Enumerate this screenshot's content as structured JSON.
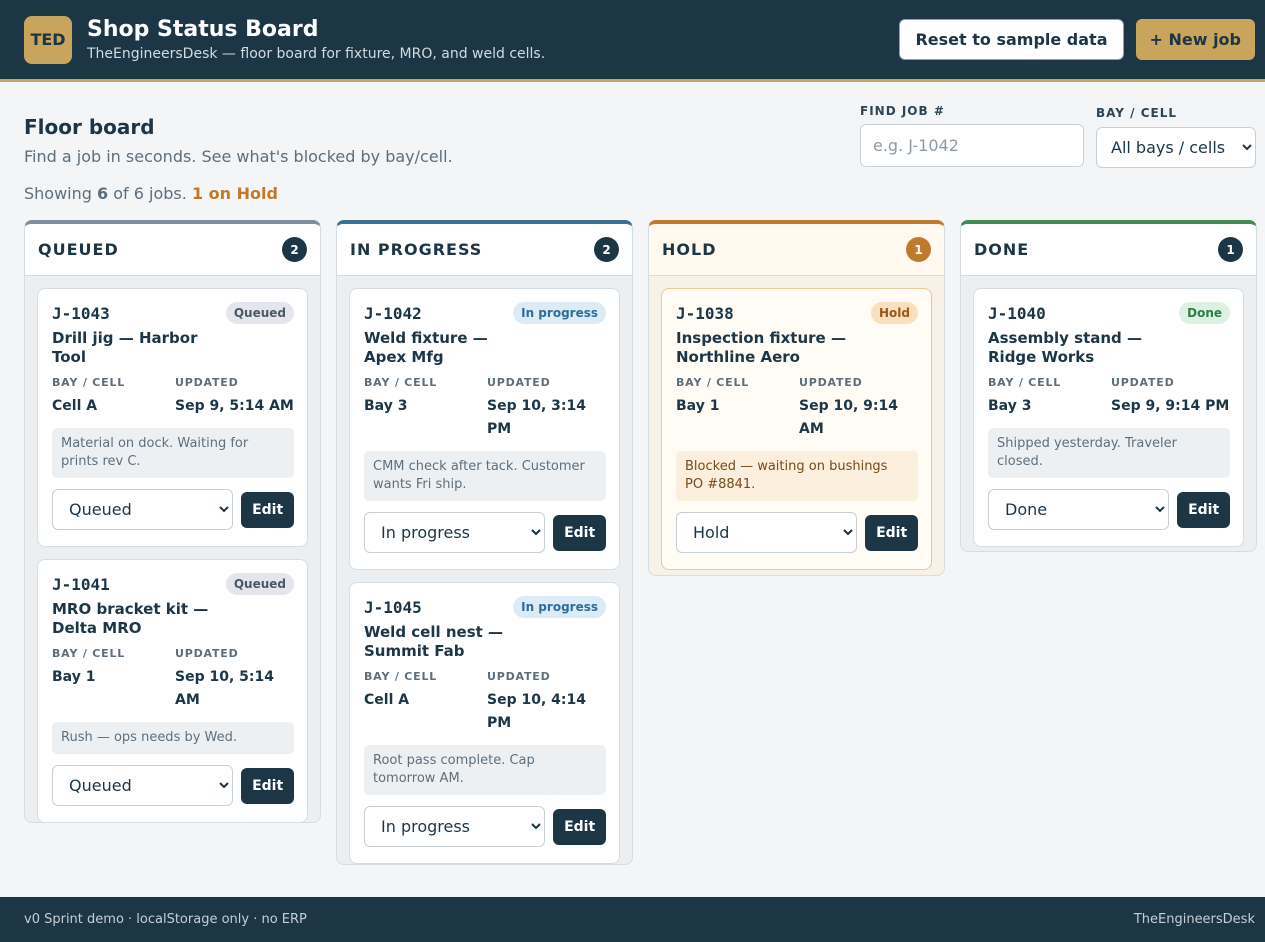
{
  "header": {
    "logo": "TED",
    "title": "Shop Status Board",
    "subtitle": "TheEngineersDesk — floor board for fixture, MRO, and weld cells.",
    "reset_label": "Reset to sample data",
    "new_job_label": "+ New job"
  },
  "intro": {
    "title": "Floor board",
    "subtitle": "Find a job in seconds. See what's blocked by bay/cell."
  },
  "summary": {
    "showing_prefix": "Showing",
    "shown": "6",
    "of_text": "of 6 jobs.",
    "hold_text": "1 on Hold"
  },
  "filters": {
    "find_label": "FIND JOB #",
    "find_placeholder": "e.g. J-1042",
    "bay_label": "BAY / CELL",
    "bay_selected": "All bays / cells"
  },
  "labels": {
    "bay": "BAY / CELL",
    "updated": "UPDATED",
    "edit": "Edit"
  },
  "columns": {
    "queued": {
      "title": "QUEUED",
      "count": "2"
    },
    "progress": {
      "title": "IN PROGRESS",
      "count": "2"
    },
    "hold": {
      "title": "HOLD",
      "count": "1"
    },
    "done": {
      "title": "DONE",
      "count": "1"
    }
  },
  "jobs": {
    "j1043": {
      "id": "J-1043",
      "badge": "Queued",
      "title": "Drill jig — Harbor Tool",
      "bay": "Cell A",
      "updated": "Sep 9, 5:14 AM",
      "note": "Material on dock. Waiting for prints rev C.",
      "status": "Queued"
    },
    "j1041": {
      "id": "J-1041",
      "badge": "Queued",
      "title": "MRO bracket kit — Delta MRO",
      "bay": "Bay 1",
      "updated": "Sep 10, 5:14 AM",
      "note": "Rush — ops needs by Wed.",
      "status": "Queued"
    },
    "j1042": {
      "id": "J-1042",
      "badge": "In progress",
      "title": "Weld fixture — Apex Mfg",
      "bay": "Bay 3",
      "updated": "Sep 10, 3:14 PM",
      "note": "CMM check after tack. Customer wants Fri ship.",
      "status": "In progress"
    },
    "j1045": {
      "id": "J-1045",
      "badge": "In progress",
      "title": "Weld cell nest — Summit Fab",
      "bay": "Cell A",
      "updated": "Sep 10, 4:14 PM",
      "note": "Root pass complete. Cap tomorrow AM.",
      "status": "In progress"
    },
    "j1038": {
      "id": "J-1038",
      "badge": "Hold",
      "title": "Inspection fixture — Northline Aero",
      "bay": "Bay 1",
      "updated": "Sep 10, 9:14 AM",
      "note": "Blocked — waiting on bushings PO #8841.",
      "status": "Hold"
    },
    "j1040": {
      "id": "J-1040",
      "badge": "Done",
      "title": "Assembly stand — Ridge Works",
      "bay": "Bay 3",
      "updated": "Sep 9, 9:14 PM",
      "note": "Shipped yesterday. Traveler closed.",
      "status": "Done"
    }
  },
  "footer": {
    "left": "v0 Sprint demo · localStorage only · no ERP",
    "right": "TheEngineersDesk"
  }
}
